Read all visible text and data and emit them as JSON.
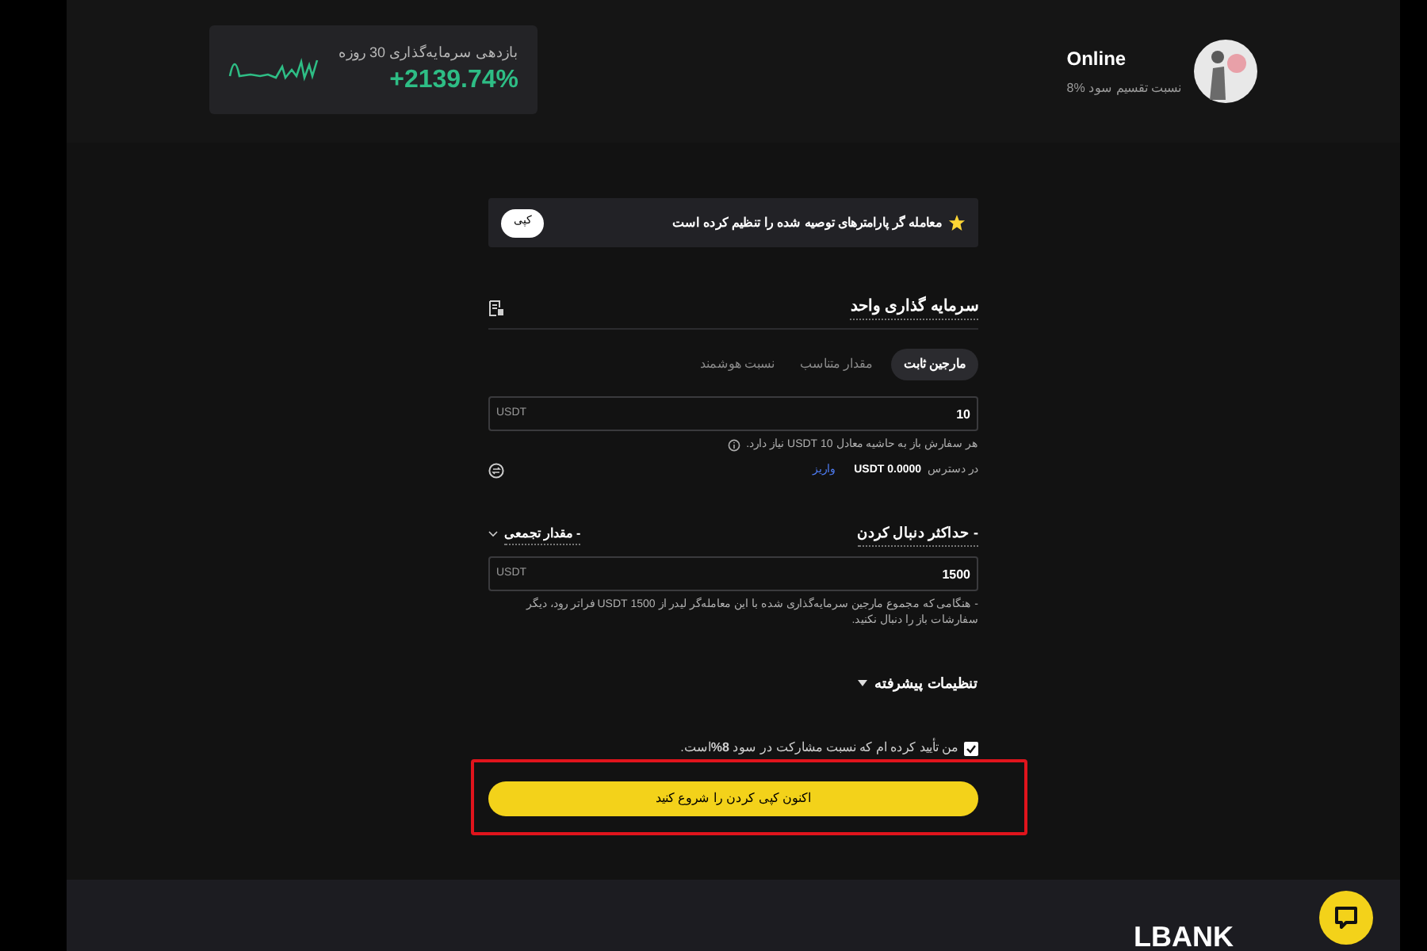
{
  "header": {
    "trader": {
      "name": "Online",
      "profit_share": "نسبت تقسیم سود %8"
    },
    "roi_card": {
      "label": "بازدهی سرمایه‌گذاری 30 روزه",
      "value": "+2139.74%"
    }
  },
  "notice": {
    "text": "معامله گر پارامترهای توصیه شده را تنظیم کرده است",
    "button": "کپی"
  },
  "unit_investment": {
    "title": "سرمایه گذاری واحد",
    "tabs": [
      {
        "label": "مارجین ثابت",
        "selected": true
      },
      {
        "label": "مقدار متناسب",
        "selected": false
      },
      {
        "label": "نسبت هوشمند",
        "selected": false
      }
    ],
    "amount_field": {
      "value": "10",
      "unit": "USDT"
    },
    "hint": "هر سفارش باز به حاشیه معادل 10 USDT نیاز دارد.",
    "available_label": "در دسترس",
    "available_value": "0.0000 USDT",
    "deposit_link": "واریز"
  },
  "max_follow": {
    "title": "- حداکثر دنبال کردن",
    "mode": "- مقدار تجمعی",
    "amount_field": {
      "value": "1500",
      "unit": "USDT"
    },
    "note": "- هنگامی که مجموع مارجین سرمایه‌گذاری شده با این معامله‌گر لیدر از 1500 USDT فراتر رود، دیگر سفارشات باز را دنبال نکنید."
  },
  "advanced_settings": {
    "label": "تنظیمات پیشرفته",
    "expanded": false
  },
  "agreement": {
    "text": "من تأیید کرده ام که نسبت مشارکت در سود **8%**است.",
    "checked": true
  },
  "start_button": "اکنون کپی کردن را شروع کنید",
  "footer": {
    "logo": "LBANK"
  }
}
